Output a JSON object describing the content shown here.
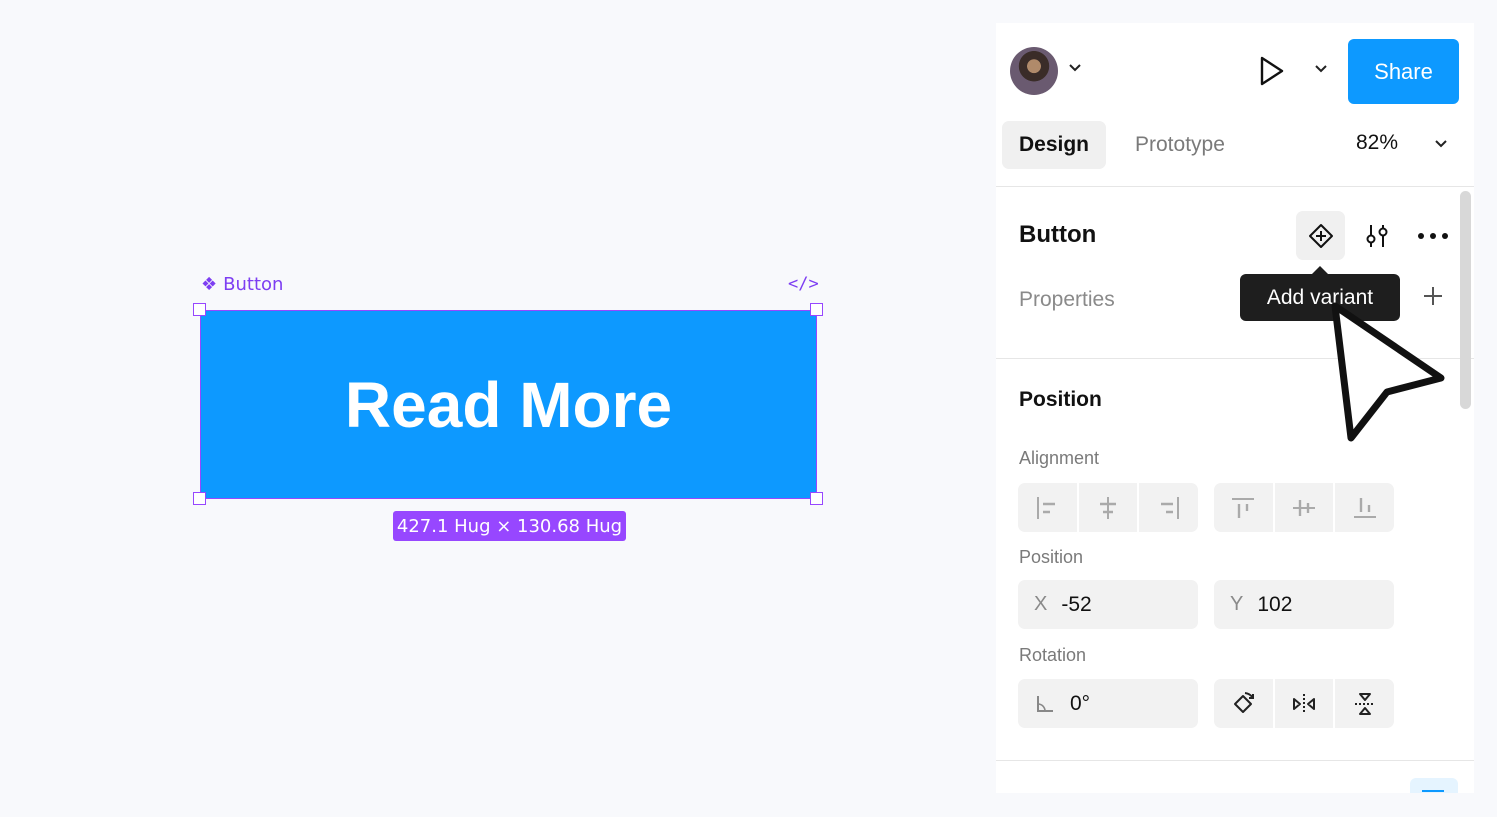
{
  "canvas": {
    "frame_label": "Button",
    "button_text": "Read More",
    "size_badge": "427.1 Hug × 130.68 Hug",
    "code_glyph": "</>"
  },
  "header": {
    "share_label": "Share",
    "tabs": [
      {
        "label": "Design",
        "active": true
      },
      {
        "label": "Prototype",
        "active": false
      }
    ],
    "zoom": "82%"
  },
  "component": {
    "name": "Button",
    "properties_label": "Properties",
    "tooltip": "Add variant"
  },
  "position_section": {
    "title": "Position",
    "alignment_label": "Alignment",
    "position_label": "Position",
    "x_prefix": "X",
    "x_value": "-52",
    "y_prefix": "Y",
    "y_value": "102",
    "rotation_label": "Rotation",
    "rotation_value": "0°"
  },
  "colors": {
    "accent": "#0d99ff",
    "selection": "#9747ff",
    "tooltip_bg": "#1e1e1e"
  }
}
